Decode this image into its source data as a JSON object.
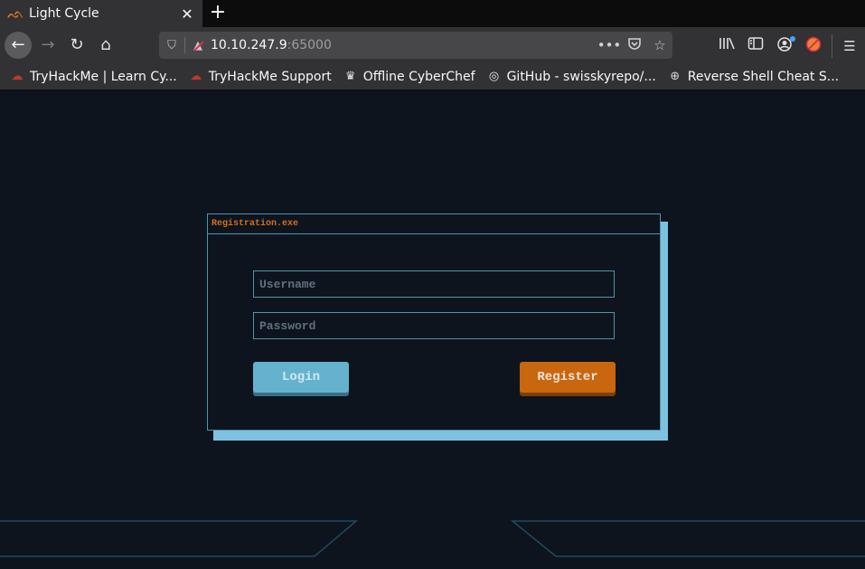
{
  "browser": {
    "tab": {
      "title": "Light Cycle",
      "icon": "light-cycle-favicon"
    },
    "new_tab_label": "+",
    "close_tab_label": "✕",
    "url": {
      "host": "10.10.247.9",
      "port": ":65000"
    },
    "nav_icons": {
      "back": "←",
      "forward": "→",
      "reload": "↻",
      "home": "⌂"
    },
    "url_icons": {
      "shield": "⛉",
      "lock": "🔒",
      "more": "•••",
      "pocket": "⛉",
      "star": "☆"
    },
    "toolbar_icons": {
      "library": "⫴",
      "sidebar": "◫",
      "account": "◉",
      "extension": "●",
      "menu": "☰"
    },
    "bookmarks": [
      {
        "label": "TryHackMe | Learn Cy...",
        "icon": "☁"
      },
      {
        "label": "TryHackMe Support",
        "icon": "☁"
      },
      {
        "label": "Offline CyberChef",
        "icon": "♛"
      },
      {
        "label": "GitHub - swisskyrepo/...",
        "icon": "◎"
      },
      {
        "label": "Reverse Shell Cheat S...",
        "icon": "⊕"
      }
    ]
  },
  "dialog": {
    "title": "Registration.exe",
    "username": {
      "value": "",
      "placeholder": "Username"
    },
    "password": {
      "value": "",
      "placeholder": "Password"
    },
    "login_label": "Login",
    "register_label": "Register"
  },
  "colors": {
    "page_bg": "#0d141e",
    "border": "#4e93ad",
    "shadow": "#7ec2df",
    "title_accent": "#d3701b",
    "login_bg": "#65b2ce",
    "register_bg": "#c8670f",
    "deco_line": "#1f4a5e"
  }
}
